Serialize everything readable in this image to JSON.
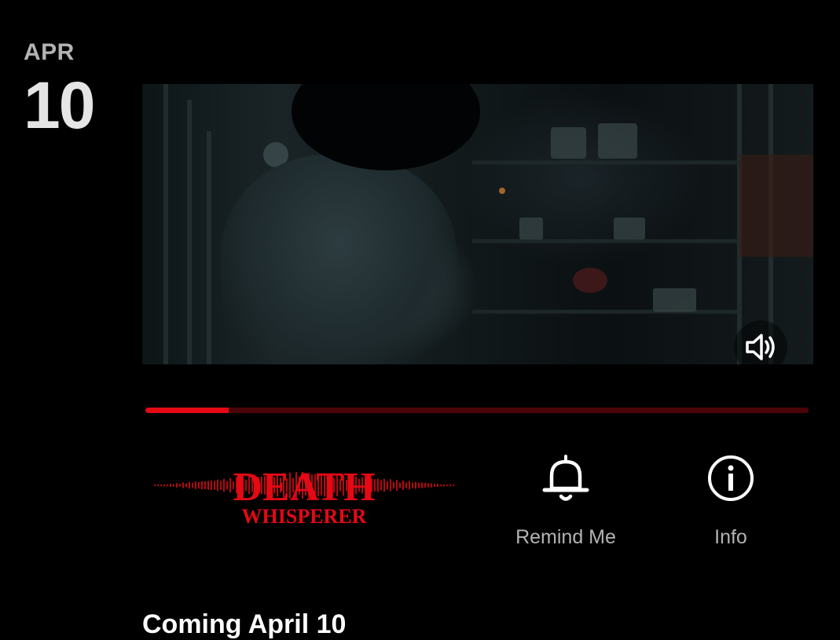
{
  "date": {
    "month": "APR",
    "day": "10"
  },
  "video": {
    "progress_fraction": 0.125
  },
  "title_logo": {
    "line1": "DEATH",
    "line2": "WHISPERER",
    "color": "#e50914"
  },
  "actions": {
    "remind": {
      "label": "Remind Me",
      "icon": "bell-icon"
    },
    "info": {
      "label": "Info",
      "icon": "info-icon"
    }
  },
  "mute_icon": "volume-icon",
  "coming_text": "Coming April 10",
  "colors": {
    "accent": "#e50914",
    "background": "#000000",
    "muted_text": "#b3b3b3"
  }
}
